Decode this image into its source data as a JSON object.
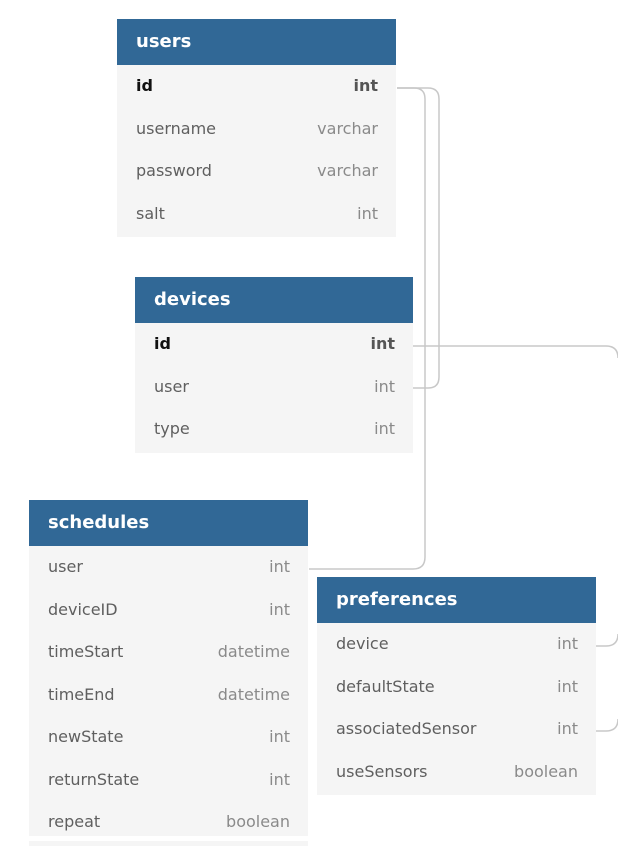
{
  "tables": {
    "users": {
      "title": "users",
      "fields": [
        {
          "name": "id",
          "type": "int"
        },
        {
          "name": "username",
          "type": "varchar"
        },
        {
          "name": "password",
          "type": "varchar"
        },
        {
          "name": "salt",
          "type": "int"
        }
      ]
    },
    "devices": {
      "title": "devices",
      "fields": [
        {
          "name": "id",
          "type": "int"
        },
        {
          "name": "user",
          "type": "int"
        },
        {
          "name": "type",
          "type": "int"
        }
      ]
    },
    "schedules": {
      "title": "schedules",
      "fields": [
        {
          "name": "user",
          "type": "int"
        },
        {
          "name": "deviceID",
          "type": "int"
        },
        {
          "name": "timeStart",
          "type": "datetime"
        },
        {
          "name": "timeEnd",
          "type": "datetime"
        },
        {
          "name": "newState",
          "type": "int"
        },
        {
          "name": "returnState",
          "type": "int"
        },
        {
          "name": "repeat",
          "type": "boolean"
        }
      ]
    },
    "preferences": {
      "title": "preferences",
      "fields": [
        {
          "name": "device",
          "type": "int"
        },
        {
          "name": "defaultState",
          "type": "int"
        },
        {
          "name": "associatedSensor",
          "type": "int"
        },
        {
          "name": "useSensors",
          "type": "boolean"
        }
      ]
    }
  },
  "colors": {
    "header": "#316896",
    "body": "#f5f5f5",
    "connector": "#c8c8c8"
  }
}
